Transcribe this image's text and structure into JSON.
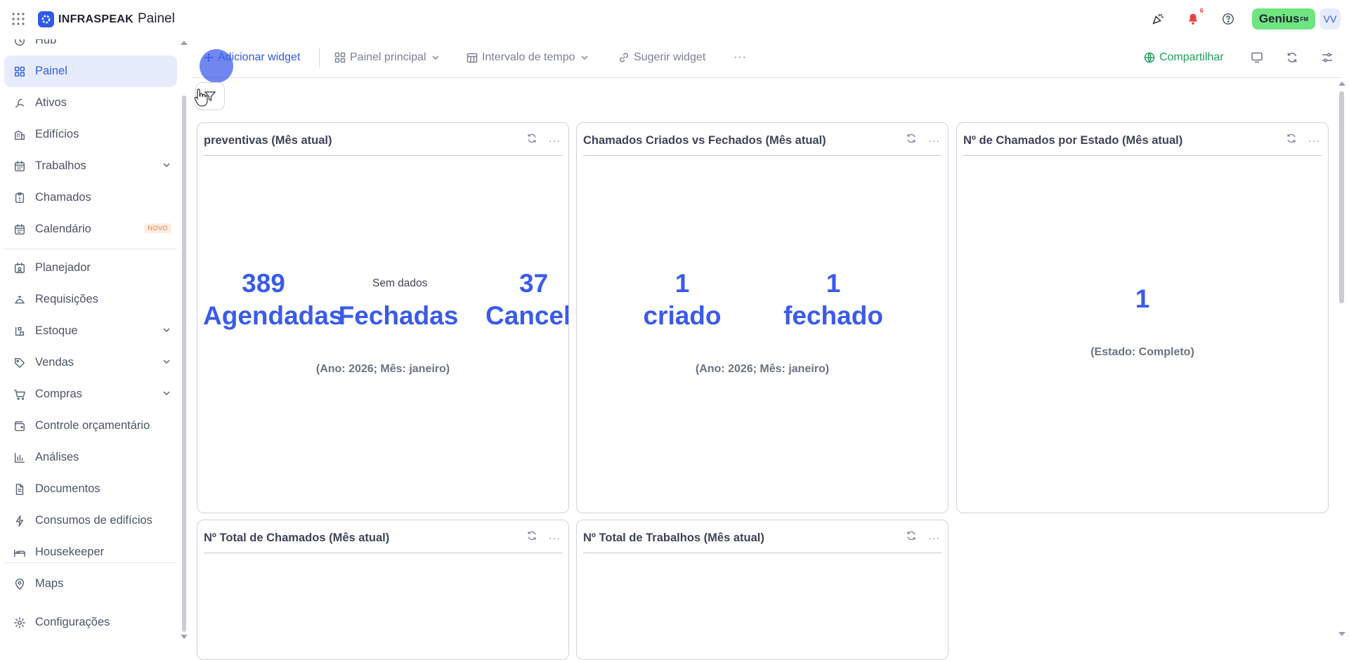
{
  "app": {
    "brand": "INFRASPEAK",
    "page_title": "Painel",
    "notifications_count": "6",
    "genius_label": "Genius",
    "genius_sup": "FM",
    "avatar_initials": "VV"
  },
  "sidebar": {
    "items": [
      {
        "label": "Hub",
        "icon": "hub-icon"
      },
      {
        "label": "Painel",
        "icon": "dashboard-icon",
        "active": true
      },
      {
        "label": "Ativos",
        "icon": "assets-icon"
      },
      {
        "label": "Edifícios",
        "icon": "building-icon"
      },
      {
        "label": "Trabalhos",
        "icon": "calendar-work-icon",
        "chevron": true
      },
      {
        "label": "Chamados",
        "icon": "clipboard-icon"
      },
      {
        "label": "Calendário",
        "icon": "calendar-icon",
        "badge": "NOVO"
      },
      {
        "label": "Planejador",
        "icon": "planner-icon"
      },
      {
        "label": "Requisições",
        "icon": "bell-service-icon"
      },
      {
        "label": "Estoque",
        "icon": "stock-icon",
        "chevron": true
      },
      {
        "label": "Vendas",
        "icon": "tag-icon",
        "chevron": true
      },
      {
        "label": "Compras",
        "icon": "cart-icon",
        "chevron": true
      },
      {
        "label": "Controle orçamentário",
        "icon": "wallet-icon"
      },
      {
        "label": "Análises",
        "icon": "bar-chart-icon"
      },
      {
        "label": "Documentos",
        "icon": "document-icon"
      },
      {
        "label": "Consumos de edifícios",
        "icon": "bolt-icon"
      },
      {
        "label": "Housekeeper",
        "icon": "bed-icon"
      },
      {
        "label": "Maps",
        "icon": "pin-icon"
      },
      {
        "label": "Configurações",
        "icon": "gear-icon"
      }
    ]
  },
  "toolbar": {
    "add_widget": "Adicionar widget",
    "main_panel": "Painel principal",
    "time_interval": "Intervalo de tempo",
    "suggest_widget": "Sugerir widget",
    "more": "···",
    "share": "Compartilhar"
  },
  "widgets": [
    {
      "title": "preventivas (Mês atual)",
      "kpis": [
        {
          "value": "389",
          "label": "Agendadas"
        },
        {
          "value": "Sem dados",
          "label": "Fechadas"
        },
        {
          "value": "37",
          "label": "Cancelad"
        }
      ],
      "subtitle": "(Ano: 2026; Mês: janeiro)"
    },
    {
      "title": "Chamados Criados vs Fechados (Mês atual)",
      "kpis": [
        {
          "value": "1",
          "label": "criado"
        },
        {
          "value": "1",
          "label": "fechado"
        }
      ],
      "subtitle": "(Ano: 2026; Mês: janeiro)"
    },
    {
      "title": "Nº de Chamados por Estado (Mês atual)",
      "kpis": [
        {
          "value": "1"
        }
      ],
      "subtitle": "(Estado: Completo)"
    },
    {
      "title": "Nº Total de Chamados (Mês atual)"
    },
    {
      "title": "Nº Total de Trabalhos (Mês atual)"
    }
  ],
  "colors": {
    "accent": "#2f5bea",
    "share_green": "#21a05a",
    "genius_green": "#6ee57f",
    "badge_red": "#e8423f"
  }
}
